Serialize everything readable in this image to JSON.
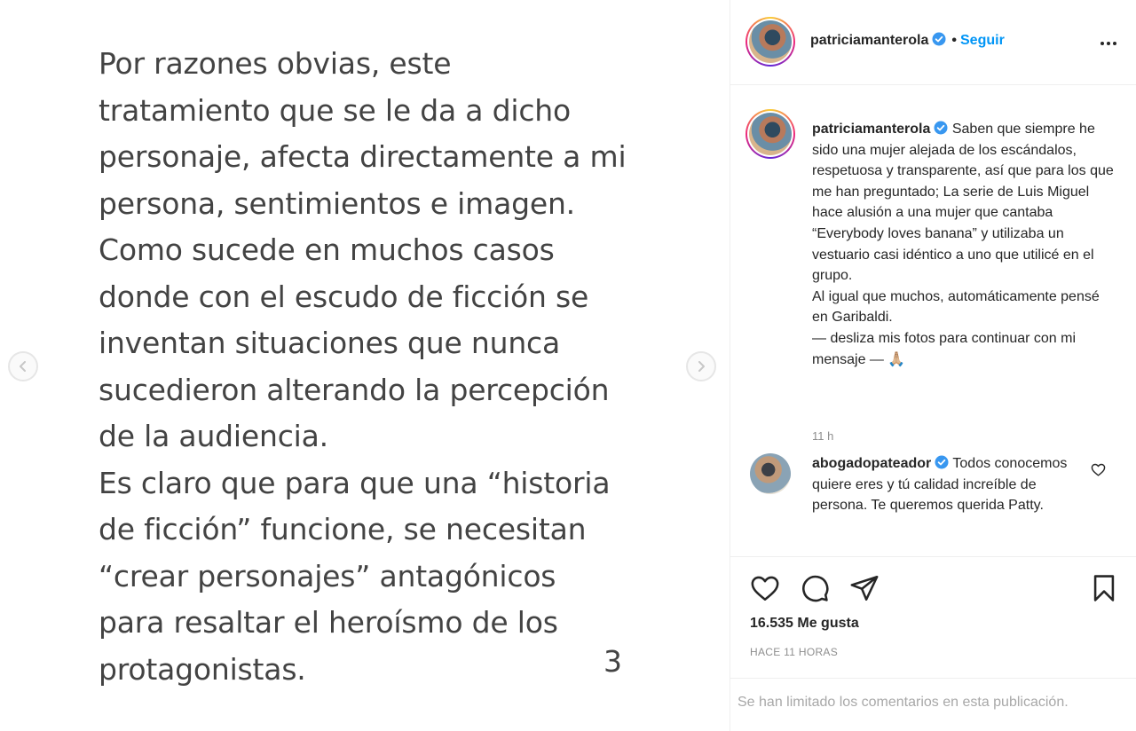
{
  "media": {
    "text_lines": [
      "Por razones obvias, este",
      "tratamiento que se le da a dicho",
      "personaje, afecta directamente a mi",
      "persona, sentimientos e imagen.",
      "Como sucede en muchos casos",
      "donde con el escudo de ficción se",
      "inventan situaciones que nunca",
      "sucedieron alterando la percepción",
      "de la audiencia.",
      "Es claro que para que una “historia",
      "de ficción” funcione, se necesitan",
      "“crear personajes” antagónicos",
      "para resaltar el heroísmo de los",
      "protagonistas."
    ],
    "page_number": "3",
    "prev_icon": "chevron-left-icon",
    "next_icon": "chevron-right-icon"
  },
  "header": {
    "username": "patriciamanterola",
    "separator": "•",
    "follow_label": "Seguir",
    "more_icon": "more-options-icon"
  },
  "caption": {
    "username": "patriciamanterola",
    "text": "Saben que siempre he sido una mujer alejada de los escándalos, respetuosa y transparente, así que para los que me han preguntado; La serie de Luis Miguel hace alusión a una mujer que cantaba “Everybody loves banana” y utilizaba un vestuario casi idéntico a uno que utilicé en el grupo.\nAl igual que muchos, automáticamente pensé en Garibaldi.\n— desliza mis fotos para continuar con mi mensaje — 🙏🏼",
    "time": "11 h"
  },
  "comment": {
    "username": "abogadopateador",
    "text": "Todos conocemos quiere eres y tú calidad increíble de persona. Te queremos querida Patty."
  },
  "actions": {
    "likes": "16.535 Me gusta",
    "posted": "HACE 11 HORAS",
    "limited_notice": "Se han limitado los comentarios en esta publicación."
  },
  "colors": {
    "link_blue": "#0095f6",
    "verified_blue": "#3897f0",
    "muted_gray": "#8e8e8e"
  }
}
